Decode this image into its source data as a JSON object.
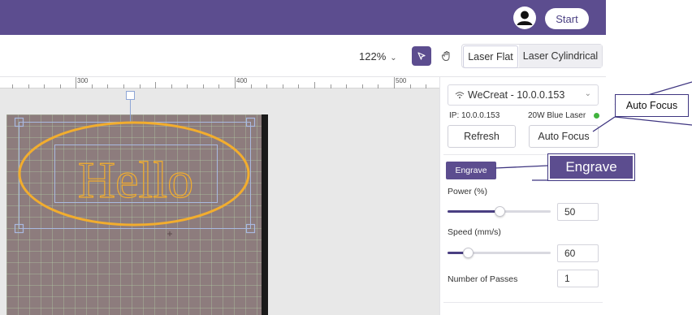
{
  "header": {
    "start_label": "Start",
    "avatar_icon": "user-avatar-icon",
    "bg_color": "#5c4d8f"
  },
  "toolbar": {
    "zoom_label": "122%",
    "zoom_caret": "⌄",
    "select_tool_icon": "cursor-arrow-icon",
    "hand_tool_icon": "hand-pan-icon",
    "modes": [
      "Laser Flat",
      "Laser Cylindrical"
    ],
    "active_mode": "Laser Flat"
  },
  "ruler": {
    "labels": [
      "300",
      "400",
      "500"
    ]
  },
  "canvas": {
    "design_text": "Hello"
  },
  "device": {
    "name": "WeCreat - 10.0.0.153",
    "ip_text": "IP: 10.0.0.153",
    "laser_text": "20W Blue Laser",
    "status_color": "#41b33e",
    "refresh_label": "Refresh",
    "autofocus_label": "Auto Focus"
  },
  "process": {
    "tab_label": "Engrave",
    "power_label": "Power  (%)",
    "power_value": "50",
    "power_fraction": 0.5,
    "speed_label": "Speed  (mm/s)",
    "speed_value": "60",
    "speed_fraction": 0.2,
    "passes_label": "Number of Passes",
    "passes_value": "1"
  },
  "callouts": {
    "autofocus": "Auto Focus",
    "engrave": "Engrave"
  }
}
